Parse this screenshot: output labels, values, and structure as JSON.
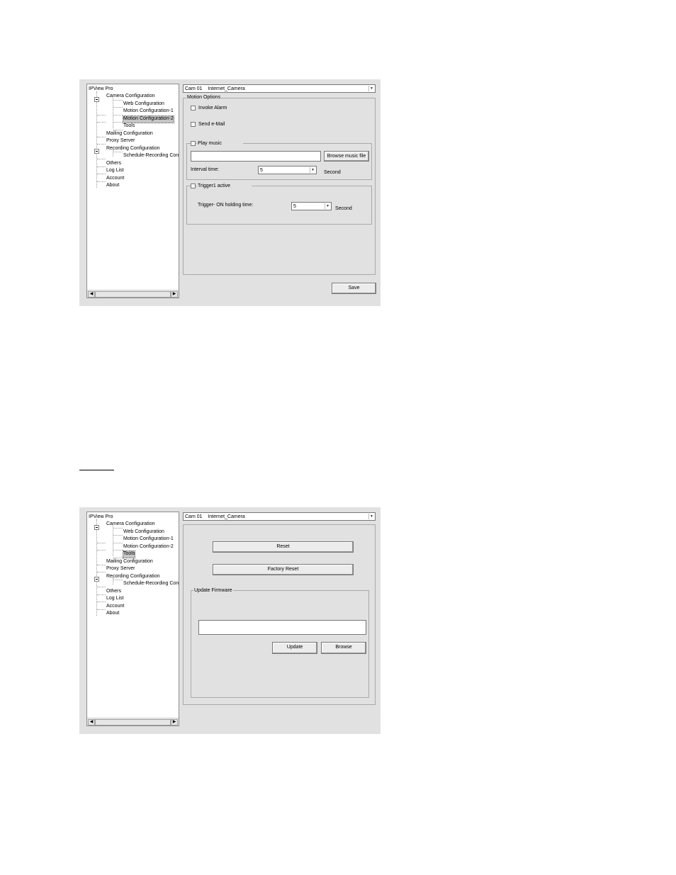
{
  "tree": {
    "root": "IPView Pro",
    "camera_config": "Camera Configuration",
    "web_config": "Web Configuration",
    "motion_config_1": "Motion Configuration-1",
    "motion_config_2": "Motion Configuration-2",
    "tools": "Tools",
    "mailing_config": "Mailing Configuration",
    "proxy_server": "Proxy Server",
    "recording_config": "Recording Configuration",
    "schedule_recording": "Schedule-Recording Con",
    "others": "Others",
    "log_list": "Log List",
    "account": "Account",
    "about": "About"
  },
  "camera_select": {
    "cam_id": "Cam 01",
    "cam_name": "Internet_Camera"
  },
  "motion_screen": {
    "selected_node": "Motion Configuration-2",
    "group_title": "Motion Options",
    "invoke_alarm": "Invoke Alarm",
    "send_email": "Send e-Mail",
    "play_music": "Play music",
    "browse_music": "Browse music file",
    "music_path": "",
    "interval_label": "Interval time:",
    "interval_value": "5",
    "interval_unit": "Second",
    "trigger_title": "Trigger1 active",
    "trigger_hold_label": "Trigger- ON holding time:",
    "trigger_hold_value": "5",
    "trigger_unit": "Second",
    "save": "Save"
  },
  "tools_screen": {
    "selected_node": "Tools",
    "reset": "Reset",
    "factory_reset": "Factory Reset",
    "firmware_title": "Update Firmware",
    "firmware_path": "",
    "update": "Update",
    "browse": "Browse"
  }
}
